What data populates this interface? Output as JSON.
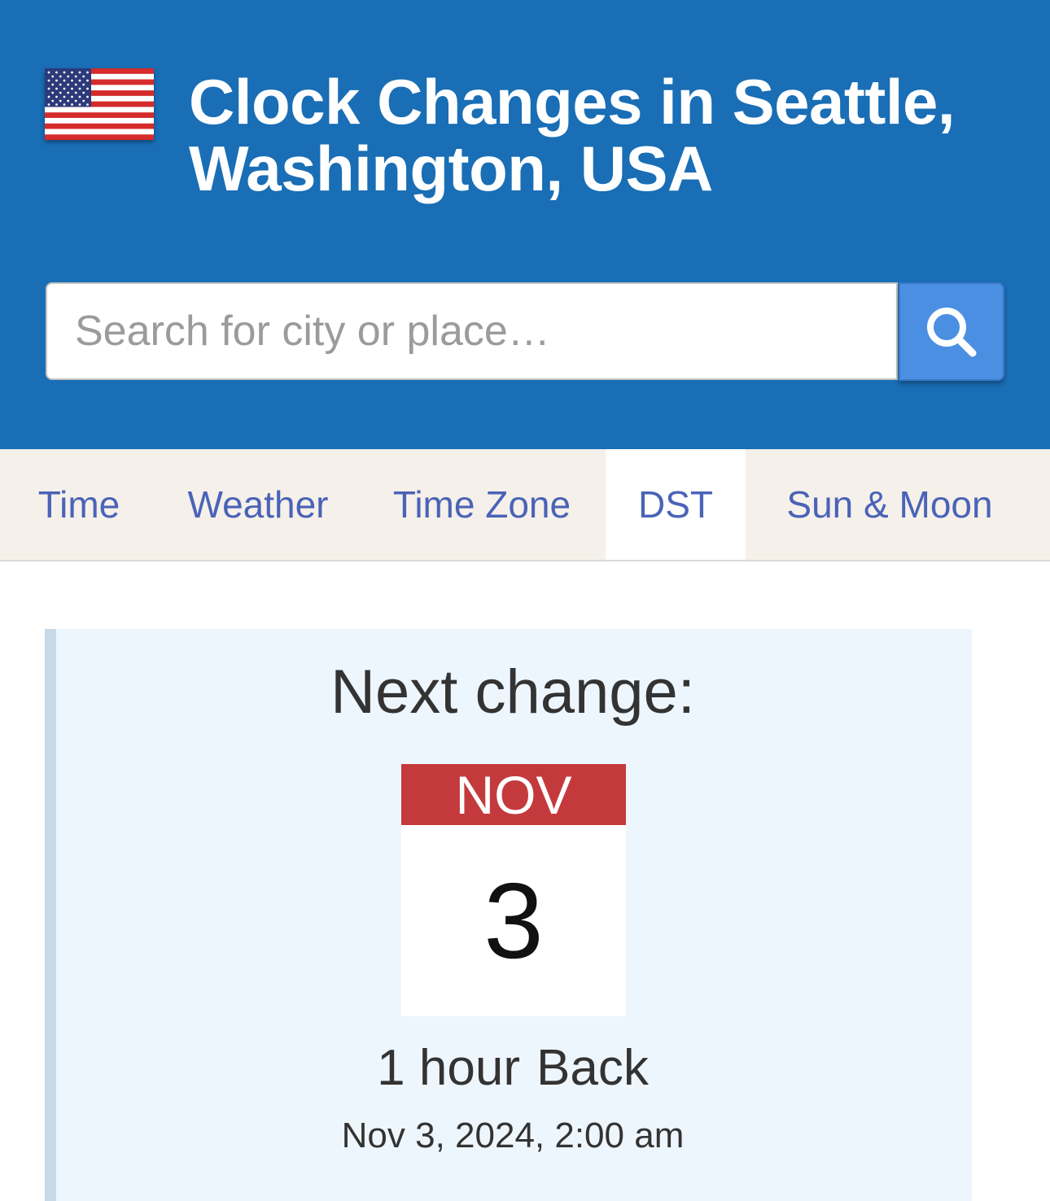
{
  "header": {
    "title": "Clock Changes in Seattle, Washington, USA",
    "flag_icon": "us-flag-icon",
    "background_color": "#196eb5"
  },
  "search": {
    "placeholder": "Search for city or place…",
    "value": "",
    "button_icon": "search-icon",
    "button_color": "#4b8fe2"
  },
  "tabs": [
    {
      "label": "Time",
      "active": false
    },
    {
      "label": "Weather",
      "active": false
    },
    {
      "label": "Time Zone",
      "active": false
    },
    {
      "label": "DST",
      "active": true
    },
    {
      "label": "Sun & Moon",
      "active": false
    }
  ],
  "next_change": {
    "label": "Next change:",
    "month": "NOV",
    "day": "3",
    "amount": "1 hour",
    "direction": "Back",
    "datetime": "Nov 3, 2024, 2:00 am",
    "month_color": "#c43a3c"
  }
}
